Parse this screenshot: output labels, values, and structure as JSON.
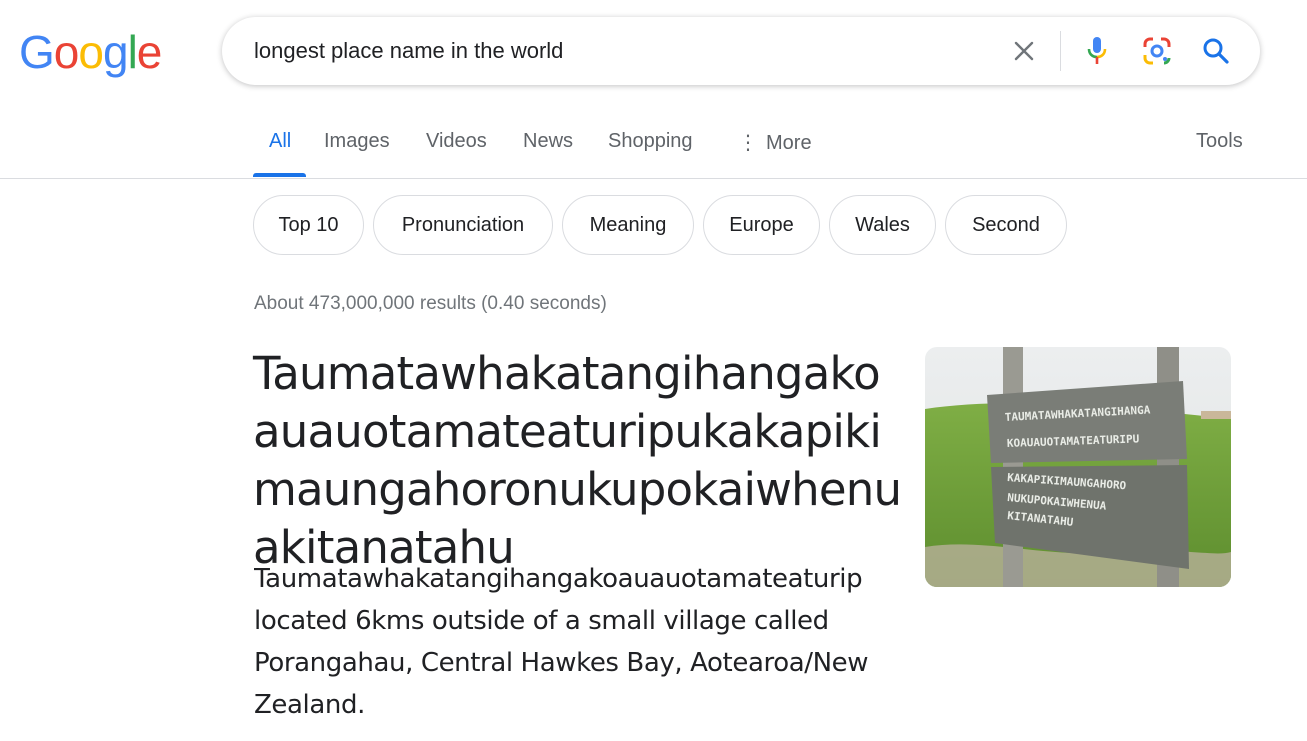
{
  "logo": {
    "text": "Google"
  },
  "search": {
    "query": "longest place name in the world",
    "clear_icon": "close-icon",
    "mic_icon": "microphone-icon",
    "lens_icon": "google-lens-icon",
    "search_icon": "search-icon"
  },
  "tabs": [
    {
      "label": "All",
      "active": true
    },
    {
      "label": "Images"
    },
    {
      "label": "Videos"
    },
    {
      "label": "News"
    },
    {
      "label": "Shopping"
    },
    {
      "label": "More"
    }
  ],
  "tools_label": "Tools",
  "chips": [
    {
      "label": "Top 10"
    },
    {
      "label": "Pronunciation"
    },
    {
      "label": "Meaning"
    },
    {
      "label": "Europe"
    },
    {
      "label": "Wales"
    },
    {
      "label": "Second"
    }
  ],
  "result_stats": "About 473,000,000 results (0.40 seconds)",
  "featured": {
    "title": "Taumatawhakatangihangakoauauotamateaturipukakapikimaungahoronukupokaiwhenuakitanatahu",
    "description_line1": "Taumatawhakatangihangakoauauotamateaturip",
    "description_rest": "located 6kms outside of a small village called Porangahau, Central Hawkes Bay, Aotearoa/New Zealand.",
    "image_sign_lines": [
      "TAUMATAWHAKATANGIHANGA",
      "KOAUAUOTAMATEATURIPU",
      "KAKAPIKIMAUNGAHORO",
      "NUKUPOKAIWHENUA",
      "KITANATAHU"
    ]
  },
  "colors": {
    "accent": "#1a73e8",
    "logo_blue": "#4285f4",
    "logo_red": "#ea4335",
    "logo_yellow": "#fbbc05",
    "logo_green": "#34a853"
  }
}
